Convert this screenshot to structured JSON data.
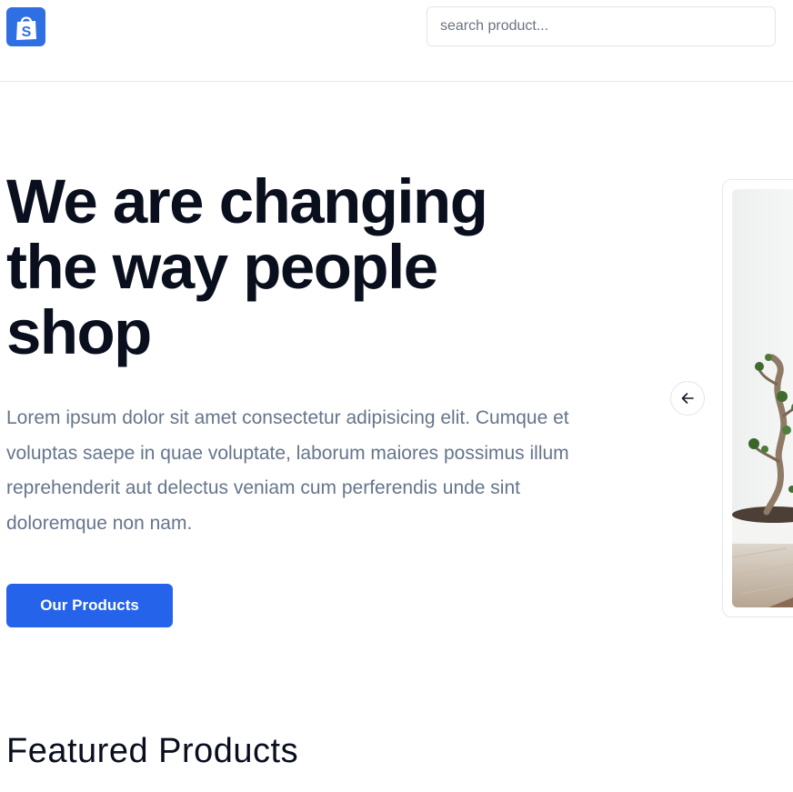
{
  "header": {
    "logo_icon": "shopping-bag-icon",
    "logo_letter": "S",
    "search": {
      "placeholder": "search product...",
      "value": ""
    }
  },
  "hero": {
    "title_lines": [
      "We are changing",
      "the way people",
      "shop"
    ],
    "description": "Lorem ipsum dolor sit amet consectetur adipisicing elit. Cumque et voluptas saepe in quae voluptate, laborum maiores possimus illum reprehenderit aut delectus veniam cum perferendis unde sint doloremque non nam.",
    "cta_label": "Our Products"
  },
  "carousel": {
    "prev_icon": "arrow-left-icon",
    "image_subject": "bonsai tree in white pot"
  },
  "featured": {
    "title": "Featured Products"
  },
  "colors": {
    "accent": "#2563eb",
    "text_dark": "#0a0f1e",
    "text_muted": "#65758b",
    "border": "#e5e7eb"
  }
}
